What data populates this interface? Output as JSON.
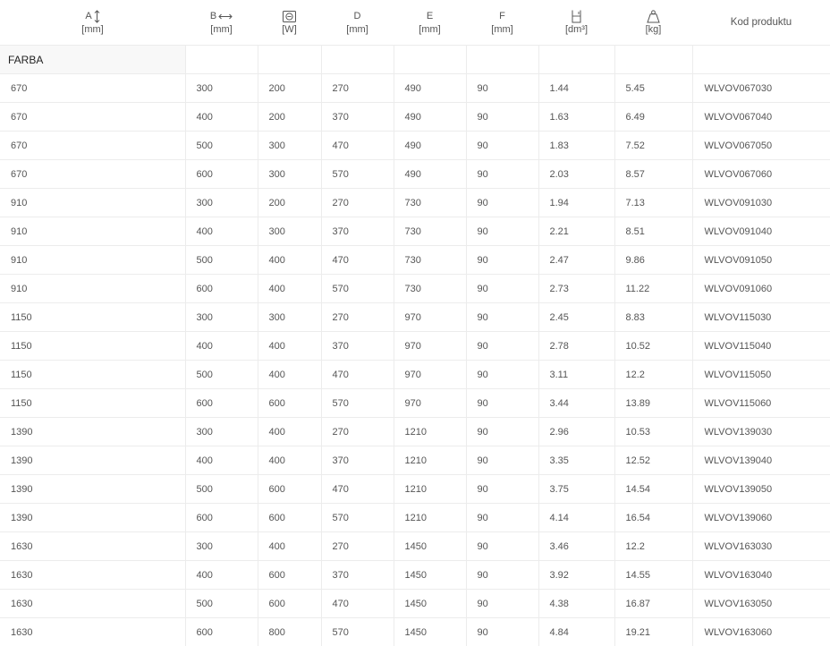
{
  "columns": [
    {
      "label": "A",
      "unit": "[mm]",
      "icon": "vertical-arrow-icon"
    },
    {
      "label": "B",
      "unit": "[mm]",
      "icon": "horizontal-arrow-icon"
    },
    {
      "label": "",
      "unit": "[W]",
      "icon": "power-icon"
    },
    {
      "label": "D",
      "unit": "[mm]"
    },
    {
      "label": "E",
      "unit": "[mm]"
    },
    {
      "label": "F",
      "unit": "[mm]"
    },
    {
      "label": "",
      "unit": "[dm³]",
      "icon": "volume-icon"
    },
    {
      "label": "",
      "unit": "[kg]",
      "icon": "weight-icon"
    },
    {
      "label": "Kod produktu",
      "unit": ""
    }
  ],
  "section_label": "FARBA",
  "rows": [
    [
      "670",
      "300",
      "200",
      "270",
      "490",
      "90",
      "1.44",
      "5.45",
      "WLVOV067030"
    ],
    [
      "670",
      "400",
      "200",
      "370",
      "490",
      "90",
      "1.63",
      "6.49",
      "WLVOV067040"
    ],
    [
      "670",
      "500",
      "300",
      "470",
      "490",
      "90",
      "1.83",
      "7.52",
      "WLVOV067050"
    ],
    [
      "670",
      "600",
      "300",
      "570",
      "490",
      "90",
      "2.03",
      "8.57",
      "WLVOV067060"
    ],
    [
      "910",
      "300",
      "200",
      "270",
      "730",
      "90",
      "1.94",
      "7.13",
      "WLVOV091030"
    ],
    [
      "910",
      "400",
      "300",
      "370",
      "730",
      "90",
      "2.21",
      "8.51",
      "WLVOV091040"
    ],
    [
      "910",
      "500",
      "400",
      "470",
      "730",
      "90",
      "2.47",
      "9.86",
      "WLVOV091050"
    ],
    [
      "910",
      "600",
      "400",
      "570",
      "730",
      "90",
      "2.73",
      "11.22",
      "WLVOV091060"
    ],
    [
      "1150",
      "300",
      "300",
      "270",
      "970",
      "90",
      "2.45",
      "8.83",
      "WLVOV115030"
    ],
    [
      "1150",
      "400",
      "400",
      "370",
      "970",
      "90",
      "2.78",
      "10.52",
      "WLVOV115040"
    ],
    [
      "1150",
      "500",
      "400",
      "470",
      "970",
      "90",
      "3.11",
      "12.2",
      "WLVOV115050"
    ],
    [
      "1150",
      "600",
      "600",
      "570",
      "970",
      "90",
      "3.44",
      "13.89",
      "WLVOV115060"
    ],
    [
      "1390",
      "300",
      "400",
      "270",
      "1210",
      "90",
      "2.96",
      "10.53",
      "WLVOV139030"
    ],
    [
      "1390",
      "400",
      "400",
      "370",
      "1210",
      "90",
      "3.35",
      "12.52",
      "WLVOV139040"
    ],
    [
      "1390",
      "500",
      "600",
      "470",
      "1210",
      "90",
      "3.75",
      "14.54",
      "WLVOV139050"
    ],
    [
      "1390",
      "600",
      "600",
      "570",
      "1210",
      "90",
      "4.14",
      "16.54",
      "WLVOV139060"
    ],
    [
      "1630",
      "300",
      "400",
      "270",
      "1450",
      "90",
      "3.46",
      "12.2",
      "WLVOV163030"
    ],
    [
      "1630",
      "400",
      "600",
      "370",
      "1450",
      "90",
      "3.92",
      "14.55",
      "WLVOV163040"
    ],
    [
      "1630",
      "500",
      "600",
      "470",
      "1450",
      "90",
      "4.38",
      "16.87",
      "WLVOV163050"
    ],
    [
      "1630",
      "600",
      "800",
      "570",
      "1450",
      "90",
      "4.84",
      "19.21",
      "WLVOV163060"
    ]
  ]
}
